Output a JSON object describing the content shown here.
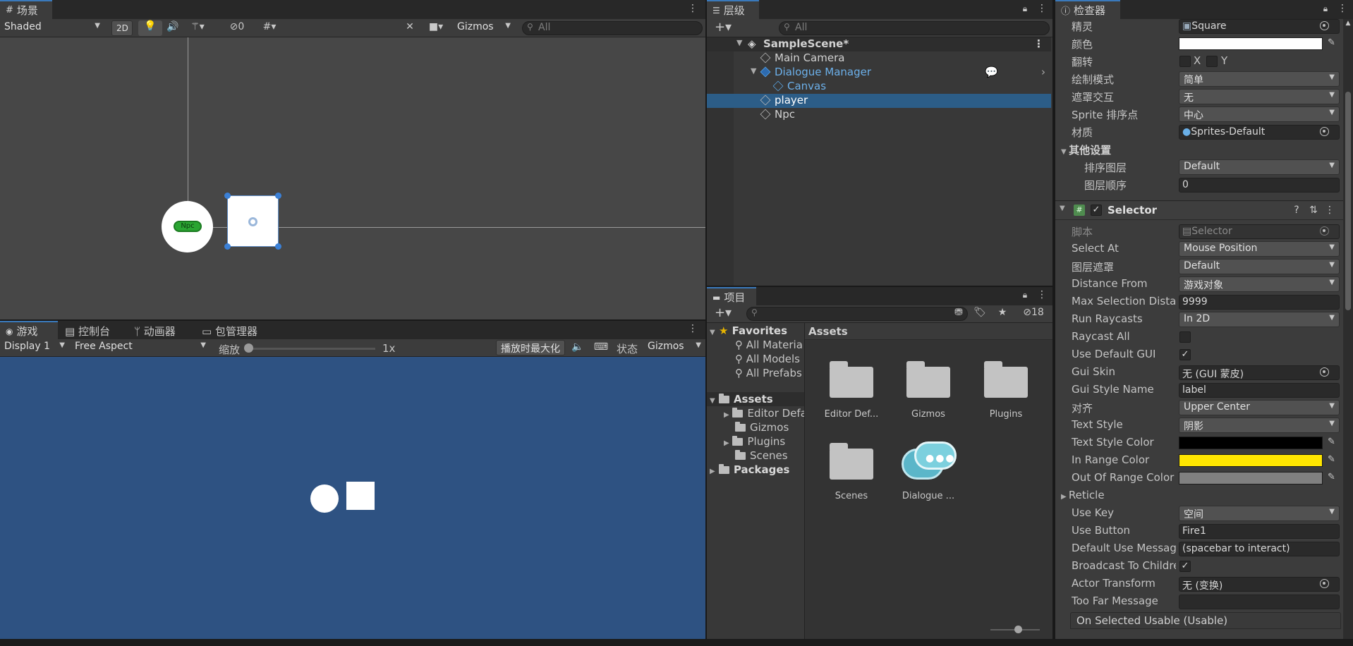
{
  "scene": {
    "tab": "场景",
    "shading": "Shaded",
    "mode2d": "2D",
    "hidden_count": "0",
    "gizmos": "Gizmos",
    "search_placeholder": "All",
    "npc_label": "Npc"
  },
  "game": {
    "tabs": [
      "游戏",
      "控制台",
      "动画器",
      "包管理器"
    ],
    "display": "Display 1",
    "aspect": "Free Aspect",
    "scale_label": "缩放",
    "scale_value": "1x",
    "maximize": "播放时最大化",
    "stats": "状态",
    "gizmos": "Gizmos",
    "bg_color": "#2e5282"
  },
  "hierarchy": {
    "tab": "层级",
    "search_placeholder": "All",
    "scene": "SampleScene*",
    "items": [
      "Main Camera",
      "Dialogue Manager",
      "Canvas",
      "player",
      "Npc"
    ]
  },
  "project": {
    "tab": "项目",
    "hidden_count": "18",
    "favorites_label": "Favorites",
    "favorites": [
      "All Materia",
      "All Models",
      "All Prefabs"
    ],
    "assets_label": "Assets",
    "asset_folders": [
      "Editor Defa",
      "Gizmos",
      "Plugins",
      "Scenes"
    ],
    "packages_label": "Packages",
    "grid_title": "Assets",
    "grid_items": [
      "Editor Def...",
      "Gizmos",
      "Plugins",
      "Scenes",
      "Dialogue ..."
    ]
  },
  "inspector": {
    "tab": "检查器",
    "sprite_rows": [
      {
        "label": "精灵",
        "value": "Square"
      },
      {
        "label": "颜色",
        "value": ""
      },
      {
        "label": "翻转",
        "value": ""
      },
      {
        "label": "绘制模式",
        "value": "简单"
      },
      {
        "label": "遮罩交互",
        "value": "无"
      },
      {
        "label": "Sprite 排序点",
        "value": "中心"
      },
      {
        "label": "材质",
        "value": "Sprites-Default"
      }
    ],
    "flip_x": "X",
    "flip_y": "Y",
    "other_settings": "其他设置",
    "sorting_layer_label": "排序图层",
    "sorting_layer": "Default",
    "order_label": "图层顺序",
    "order": "0",
    "component": "Selector",
    "rows": [
      {
        "label": "脚本",
        "value": "Selector"
      },
      {
        "label": "Select At",
        "value": "Mouse Position"
      },
      {
        "label": "图层遮罩",
        "value": "Default"
      },
      {
        "label": "Distance From",
        "value": "游戏对象"
      },
      {
        "label": "Max Selection Distance",
        "value": "9999"
      },
      {
        "label": "Run Raycasts",
        "value": "In 2D"
      },
      {
        "label": "Raycast All",
        "value": ""
      },
      {
        "label": "Use Default GUI",
        "value": "✓"
      },
      {
        "label": "Gui Skin",
        "value": "无 (GUI 蒙皮)"
      },
      {
        "label": "Gui Style Name",
        "value": "label"
      },
      {
        "label": "对齐",
        "value": "Upper Center"
      },
      {
        "label": "Text Style",
        "value": "阴影"
      },
      {
        "label": "Text Style Color",
        "value": ""
      },
      {
        "label": "In Range Color",
        "value": ""
      },
      {
        "label": "Out Of Range Color",
        "value": ""
      },
      {
        "label": "Reticle",
        "value": ""
      },
      {
        "label": "Use Key",
        "value": "空间"
      },
      {
        "label": "Use Button",
        "value": "Fire1"
      },
      {
        "label": "Default Use Message",
        "value": "(spacebar to interact)"
      },
      {
        "label": "Broadcast To Children",
        "value": "✓"
      },
      {
        "label": "Actor Transform",
        "value": "无 (变换)"
      },
      {
        "label": "Too Far Message",
        "value": ""
      }
    ],
    "event_header": "On Selected Usable (Usable)",
    "colors": {
      "sprite": "#ffffff",
      "text_style": "#000000",
      "in_range": "#ffe600",
      "out_of_range": "#808080"
    }
  },
  "colors": {
    "accent": "#3a79bb",
    "selection": "#2c5d87",
    "bg": "#383838"
  }
}
